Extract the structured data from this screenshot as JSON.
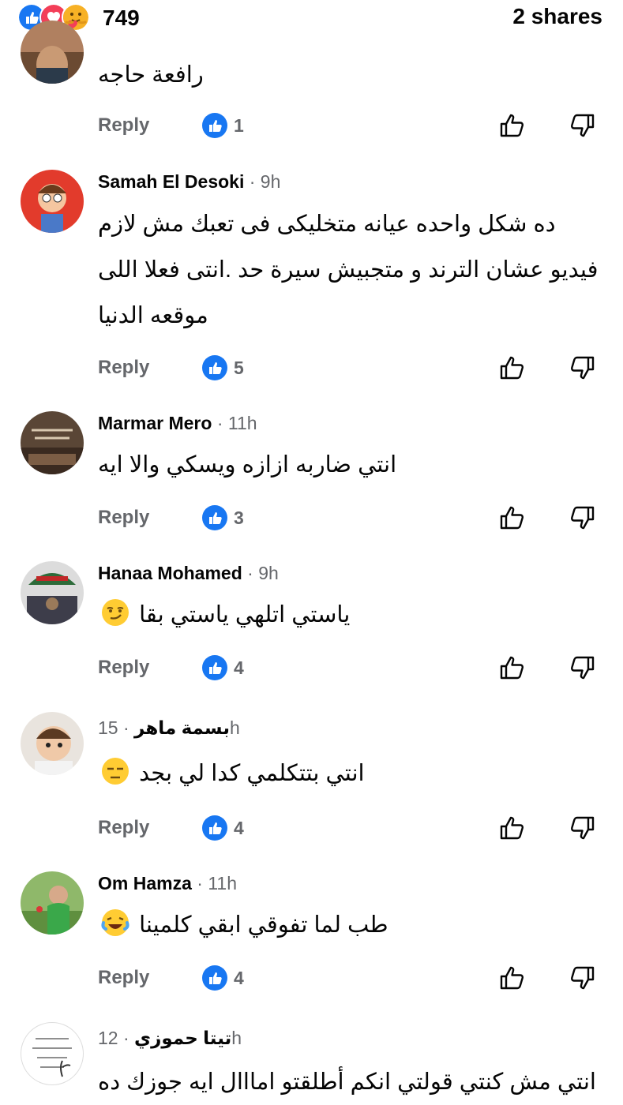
{
  "header": {
    "reaction_icons": [
      "like-icon",
      "love-icon",
      "care-icon"
    ],
    "reaction_count": "749",
    "shares": "2 shares"
  },
  "labels": {
    "reply": "Reply"
  },
  "colors": {
    "like_blue": "#1877f2",
    "love_red": "#f33e58",
    "meta_gray": "#65676b"
  },
  "comments": [
    {
      "author": "",
      "time": "",
      "text": "رافعة حاجه",
      "likes": "1"
    },
    {
      "author": "Samah El Desoki",
      "time": " · 9h",
      "lines": [
        "ده شكل واحده عيانه متخليكى فى تعبك مش لازم",
        "فيديو عشان الترند و متجبيش سيرة حد .انتى فعلا اللى",
        "موقعه الدنيا"
      ],
      "likes": "5"
    },
    {
      "author": "Marmar Mero",
      "time": " · 11h",
      "text": "انتي ضاربه ازازه ويسكي والا ايه",
      "likes": "3"
    },
    {
      "author": "Hanaa Mohamed",
      "time": " · 9h",
      "text": "ياستي اتلهي ياستي بقا",
      "emoji": "smirk-emoji",
      "likes": "4"
    },
    {
      "author": "بسمة ماهر",
      "time": " · 15h",
      "text": "انتي بتتكلمي كدا لي بجد",
      "emoji": "unamused-emoji",
      "likes": "4"
    },
    {
      "author": "Om Hamza",
      "time": " · 11h",
      "text": "طب لما تفوقي ابقي كلمينا",
      "emoji": "laughing-tears-emoji",
      "likes": "4"
    },
    {
      "author": "تيتا حموزي",
      "time": " · 12h",
      "text": "انتي مش كنتي قولتي انكم أطلقتو امااال ايه جوزك ده"
    }
  ]
}
